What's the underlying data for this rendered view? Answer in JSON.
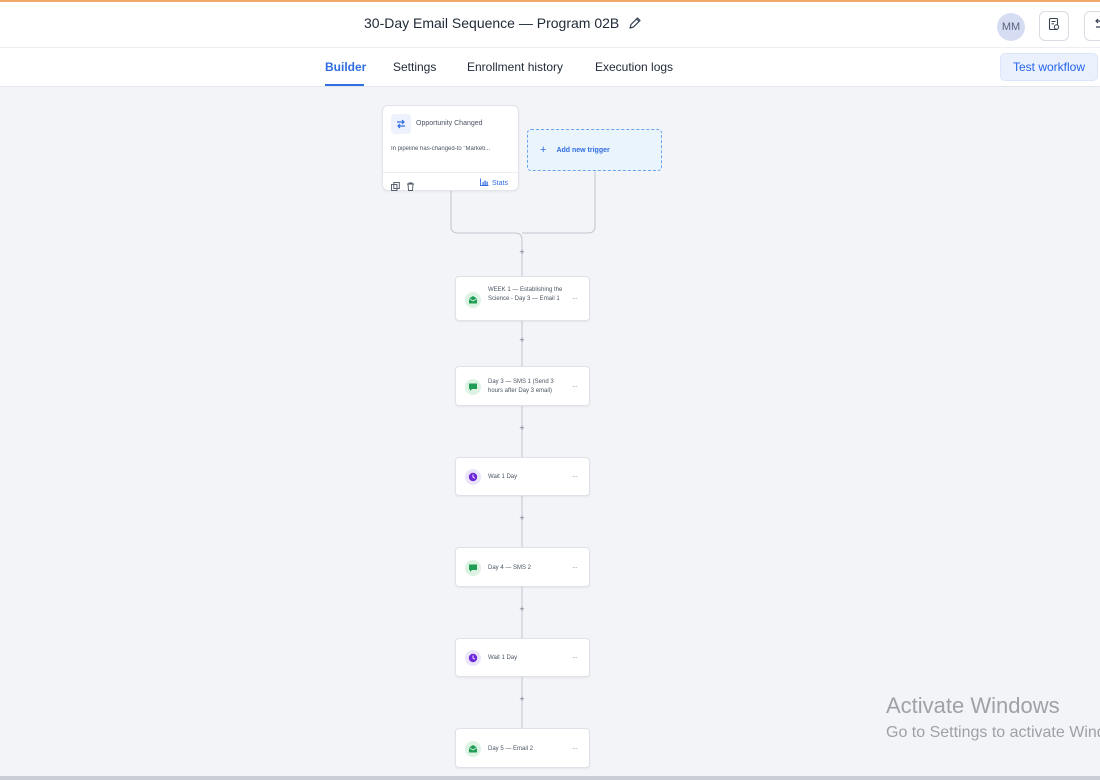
{
  "header": {
    "title": "30-Day Email Sequence — Program 02B",
    "avatar_initials": "MM"
  },
  "tabs": [
    {
      "label": "Builder",
      "active": true
    },
    {
      "label": "Settings",
      "active": false
    },
    {
      "label": "Enrollment history",
      "active": false
    },
    {
      "label": "Execution logs",
      "active": false
    }
  ],
  "test_workflow_label": "Test workflow",
  "trigger": {
    "title": "Opportunity Changed",
    "description": "In pipeline has-changed-to \"Marketi...",
    "stats_label": "Stats"
  },
  "add_trigger_label": "Add new trigger",
  "actions": [
    {
      "label": "WEEK 1 — Establishing the Science - Day 3 — Email 1",
      "type": "email",
      "more": "···"
    },
    {
      "label": "Day 3 — SMS 1 (Send 3 hours after Day 3 email)",
      "type": "sms",
      "more": "···"
    },
    {
      "label": "Wait 1 Day",
      "type": "wait",
      "more": "···"
    },
    {
      "label": "Day 4 — SMS 2",
      "type": "sms",
      "more": "···"
    },
    {
      "label": "Wait 1 Day",
      "type": "wait",
      "more": "···"
    },
    {
      "label": "Day 5 — Email 2",
      "type": "email",
      "more": "···"
    }
  ],
  "plus_symbol": "+",
  "watermark": {
    "line1": "Activate Windows",
    "line2": "Go to Settings to activate Windows."
  },
  "colors": {
    "accent": "#2f6de1",
    "email_icon": "#1f9d55",
    "sms_icon": "#1f9d55",
    "wait_icon": "#6d28d9"
  }
}
